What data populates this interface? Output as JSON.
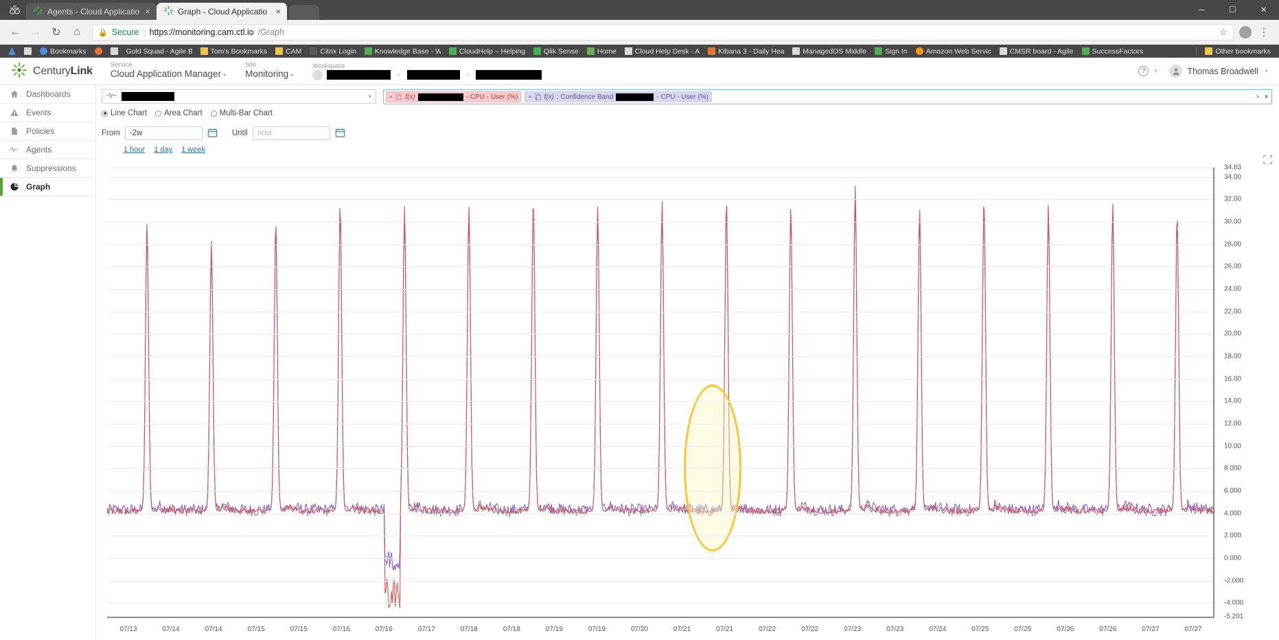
{
  "browser": {
    "tabs": [
      {
        "title": "Agents - Cloud Applicatio",
        "active": false,
        "close": "×"
      },
      {
        "title": "Graph - Cloud Applicatio",
        "active": true,
        "close": "×"
      }
    ],
    "window_controls": {
      "minimize": "─",
      "maximize": "☐",
      "close": "✕"
    },
    "nav": {
      "back": "←",
      "forward": "→",
      "reload": "↻",
      "home": "⌂"
    },
    "omnibox": {
      "lock_icon": "lock-icon",
      "secure_label": "Secure",
      "separator": "|",
      "url_main": "https://monitoring.cam.ctl.io",
      "url_path": "/Graph",
      "star_icon": "☆",
      "menu_icon": "⋮"
    },
    "bookmarks": [
      {
        "label": "Bookmarks",
        "icon_color": "#4a90e2"
      },
      {
        "label": "Gold Squad - Agile B",
        "icon_color": "#e8732c"
      },
      {
        "label": "Tom's Bookmarks",
        "icon_color": "#f5c242"
      },
      {
        "label": "CAM",
        "icon_color": "#f5c242"
      },
      {
        "label": "Citrix Login",
        "icon_color": "#4a4a4a"
      },
      {
        "label": "Knowledge Base - W",
        "icon_color": "#4caf50"
      },
      {
        "label": "CloudHelp – Helping",
        "icon_color": "#4caf50"
      },
      {
        "label": "Qlik Sense",
        "icon_color": "#3cb54a"
      },
      {
        "label": "Home",
        "icon_color": "#6ab04c"
      },
      {
        "label": "Cloud Help Desk - A",
        "icon_color": "#c0c0c0"
      },
      {
        "label": "Kibana 3 - Daily Hea",
        "icon_color": "#e8732c"
      },
      {
        "label": "ManagedOS Middle",
        "icon_color": "#d8d8d8"
      },
      {
        "label": "Sign In",
        "icon_color": "#4caf50"
      },
      {
        "label": "Amazon Web Servic",
        "icon_color": "#ff9900"
      },
      {
        "label": "CMSR board - Agile",
        "icon_color": "#d8d8d8"
      },
      {
        "label": "SuccessFactors",
        "icon_color": "#4caf50"
      }
    ],
    "other_bookmarks": {
      "label": "Other bookmarks",
      "icon_color": "#f5c242"
    }
  },
  "app_header": {
    "brand": {
      "name_light": "Century",
      "name_bold": "Link",
      "logo": "centurylink-logo-icon"
    },
    "service": {
      "label": "Service",
      "value": "Cloud Application Manager"
    },
    "site": {
      "label": "Site",
      "value": "Monitoring"
    },
    "workspace": {
      "label": "Workspace",
      "crumb1": "",
      "crumb2": "",
      "crumb3": "",
      "separator": "›"
    },
    "help": {
      "icon": "help-icon"
    },
    "user": {
      "name": "Thomas Broadwell",
      "avatar": "user-avatar-icon"
    }
  },
  "sidebar": {
    "items": [
      {
        "label": "Dashboards",
        "icon": "home-icon",
        "active": false
      },
      {
        "label": "Events",
        "icon": "warning-triangle-icon",
        "active": false
      },
      {
        "label": "Policies",
        "icon": "document-icon",
        "active": false
      },
      {
        "label": "Agents",
        "icon": "pulse-icon",
        "active": false
      },
      {
        "label": "Suppressions",
        "icon": "bell-icon",
        "active": false
      },
      {
        "label": "Graph",
        "icon": "pie-chart-icon",
        "active": true
      }
    ]
  },
  "controls": {
    "metric_select": {
      "icon": "pulse-icon",
      "value": "",
      "caret": "▾"
    },
    "chart_types": [
      {
        "label": "Line Chart",
        "selected": true
      },
      {
        "label": "Area Chart",
        "selected": false
      },
      {
        "label": "Multi-Bar Chart",
        "selected": false
      }
    ],
    "from": {
      "label": "From",
      "value": "-2w",
      "placeholder": ""
    },
    "until": {
      "label": "Until",
      "value": "",
      "placeholder": "now"
    },
    "calendar_icon": "calendar-icon",
    "quick_ranges": [
      "1 hour",
      "1 day",
      "1 week"
    ],
    "expand_icon": "expand-icon"
  },
  "series_pills": [
    {
      "remove": "×",
      "copy_icon": "copy-icon",
      "fn": "f(x)",
      "redacted_width": 58,
      "suffix": " - CPU - User (%)",
      "style": "red"
    },
    {
      "remove": "×",
      "copy_icon": "copy-icon",
      "fn": "f(x)",
      "prefix": " : Confidence Band",
      "redacted_width": 48,
      "suffix": " - CPU - User (%)",
      "style": "purple"
    }
  ],
  "pillbox_actions": {
    "clear": "×",
    "caret": "▾"
  },
  "chart_data": {
    "type": "line",
    "title": "",
    "xlabel": "",
    "ylabel": "",
    "ylim": [
      -5.201,
      34.83
    ],
    "grid": true,
    "legend_position": "top",
    "y_ticks": [
      "34.83",
      "34.00",
      "32.00",
      "30.00",
      "28.00",
      "26.00",
      "24.00",
      "22.00",
      "20.00",
      "18.00",
      "16.00",
      "14.00",
      "12.00",
      "10.00",
      "8.000",
      "6.000",
      "4.000",
      "2.000",
      "0.000",
      "-2.000",
      "-4.000",
      "-5.201"
    ],
    "y_tick_values": [
      34.83,
      34,
      32,
      30,
      28,
      26,
      24,
      22,
      20,
      18,
      16,
      14,
      12,
      10,
      8,
      6,
      4,
      2,
      0,
      -2,
      -4,
      -5.201
    ],
    "x_ticks": [
      "07/13",
      "07/14",
      "07/14",
      "07/15",
      "07/15",
      "07/16",
      "07/16",
      "07/17",
      "07/18",
      "07/18",
      "07/19",
      "07/19",
      "07/20",
      "07/21",
      "07/21",
      "07/22",
      "07/22",
      "07/23",
      "07/23",
      "07/24",
      "07/25",
      "07/25",
      "07/26",
      "07/26",
      "07/27",
      "07/27"
    ],
    "series": [
      {
        "name": "CPU - User (%)",
        "color": "#d9534f",
        "baseline": 4.2,
        "spike_peaks": [
          30.0,
          28.3,
          30.2,
          31.8,
          31.4,
          31.6,
          32.3,
          31.5,
          31.9,
          32.2,
          31.6,
          33.2,
          31.4,
          32.3,
          31.6,
          31.7,
          31.0
        ],
        "note": "red line: observed CPU user percent, 2-week window, regular daily spikes to ~28-33% over ~4.2% baseline"
      },
      {
        "name": "Confidence Band - CPU - User (%)",
        "color": "#7e62c8",
        "baseline": 4.3,
        "note": "purple line: confidence band envelope tracking the observed series"
      }
    ],
    "annotation": {
      "type": "ellipse-highlight",
      "color": "#fdc22d",
      "fill": "#fff9c4",
      "x_center_label": "07/20",
      "description": "Yellow ellipse highlighting an anomalous spike region near 07/20-07/21"
    }
  }
}
